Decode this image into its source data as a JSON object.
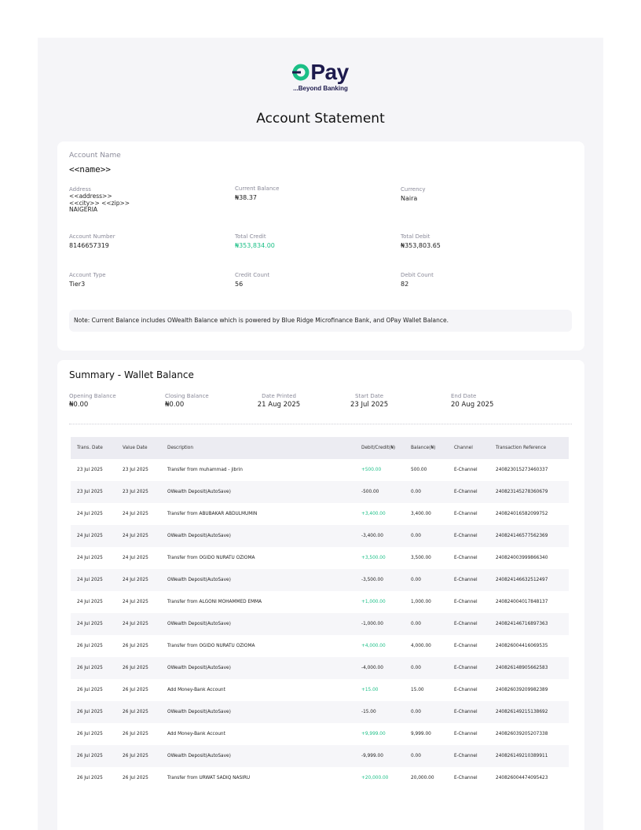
{
  "brand": {
    "name": "Pay",
    "tagline": "...Beyond Banking",
    "colors": {
      "primary": "#1d1a4d",
      "accent": "#1bbf86"
    }
  },
  "title": "Account Statement",
  "account": {
    "name_label": "Account Name",
    "name": "<<name>>",
    "address_label": "Address",
    "address_line1": "<<address>>",
    "address_line2": "<<city>> <<zip>>",
    "address_line3": "NAIGERIA",
    "current_balance_label": "Current Balance",
    "current_balance": "₦38.37",
    "currency_label": "Currency",
    "currency": "Naira",
    "account_number_label": "Account Number",
    "account_number": "8146657319",
    "total_credit_label": "Total Credit",
    "total_credit": "₦353,834.00",
    "total_debit_label": "Total Debit",
    "total_debit": "₦353,803.65",
    "account_type_label": "Account Type",
    "account_type": "Tier3",
    "credit_count_label": "Credit Count",
    "credit_count": "56",
    "debit_count_label": "Debit Count",
    "debit_count": "82",
    "note": "Note: Current Balance includes OWealth Balance which is powered by Blue Ridge Microfinance Bank, and OPay Wallet Balance."
  },
  "summary": {
    "title": "Summary - Wallet Balance",
    "opening_label": "Opening Balance",
    "opening": "₦0.00",
    "closing_label": "Closing Balance",
    "closing": "₦0.00",
    "printed_label": "Date Printed",
    "printed": "21 Aug 2025",
    "start_label": "Start Date",
    "start": "23 Jul 2025",
    "end_label": "End Date",
    "end": "20 Aug 2025"
  },
  "table": {
    "headers": [
      "Trans. Date",
      "Value Date",
      "Description",
      "Debit/Credit(₦)",
      "Balance(₦)",
      "Channel",
      "Transaction Reference"
    ],
    "rows": [
      [
        "23 Jul  2025",
        "23 Jul  2025",
        "Transfer from muhammad - jibrin",
        "+500.00",
        "500.00",
        "E-Channel",
        "240823015273460337"
      ],
      [
        "23 Jul  2025",
        "23 Jul  2025",
        "OWealth Deposit(AutoSave)",
        "-500.00",
        "0.00",
        "E-Channel",
        "240823145278360679"
      ],
      [
        "24 Jul  2025",
        "24 Jul  2025",
        "Transfer from ABUBAKAR ABDULMUMIN",
        "+3,400.00",
        "3,400.00",
        "E-Channel",
        "240824016582099752"
      ],
      [
        "24 Jul  2025",
        "24 Jul  2025",
        "OWealth Deposit(AutoSave)",
        "-3,400.00",
        "0.00",
        "E-Channel",
        "240824146577562369"
      ],
      [
        "24 Jul  2025",
        "24 Jul  2025",
        "Transfer from OGIDO NURATU OZIOMA",
        "+3,500.00",
        "3,500.00",
        "E-Channel",
        "240824003999866340"
      ],
      [
        "24 Jul  2025",
        "24 Jul  2025",
        "OWealth Deposit(AutoSave)",
        "-3,500.00",
        "0.00",
        "E-Channel",
        "240824146632512497"
      ],
      [
        "24 Jul  2025",
        "24 Jul  2025",
        "Transfer from ALGONI MOHAMMED EMMA",
        "+1,000.00",
        "1,000.00",
        "E-Channel",
        "240824004017848137"
      ],
      [
        "24 Jul  2025",
        "24 Jul  2025",
        "OWealth Deposit(AutoSave)",
        "-1,000.00",
        "0.00",
        "E-Channel",
        "240824146716897363"
      ],
      [
        "26 Jul  2025",
        "26 Jul  2025",
        "Transfer from OGIDO NURATU OZIOMA",
        "+4,000.00",
        "4,000.00",
        "E-Channel",
        "240826004416069535"
      ],
      [
        "26 Jul  2025",
        "26 Jul  2025",
        "OWealth Deposit(AutoSave)",
        "-4,000.00",
        "0.00",
        "E-Channel",
        "240826148905662583"
      ],
      [
        "26 Jul  2025",
        "26 Jul  2025",
        "Add Money-Bank Account",
        "+15.00",
        "15.00",
        "E-Channel",
        "240826039209982389"
      ],
      [
        "26 Jul  2025",
        "26 Jul  2025",
        "OWealth Deposit(AutoSave)",
        "-15.00",
        "0.00",
        "E-Channel",
        "240826149215138692"
      ],
      [
        "26 Jul  2025",
        "26 Jul  2025",
        "Add Money-Bank Account",
        "+9,999.00",
        "9,999.00",
        "E-Channel",
        "240826039205207338"
      ],
      [
        "26 Jul  2025",
        "26 Jul  2025",
        "OWealth Deposit(AutoSave)",
        "-9,999.00",
        "0.00",
        "E-Channel",
        "240826149210389911"
      ],
      [
        "26 Jul  2025",
        "26 Jul  2025",
        "Transfer from URWAT SADIQ NASIRU",
        "+20,000.00",
        "20,000.00",
        "E-Channel",
        "240826004474095423"
      ]
    ]
  }
}
